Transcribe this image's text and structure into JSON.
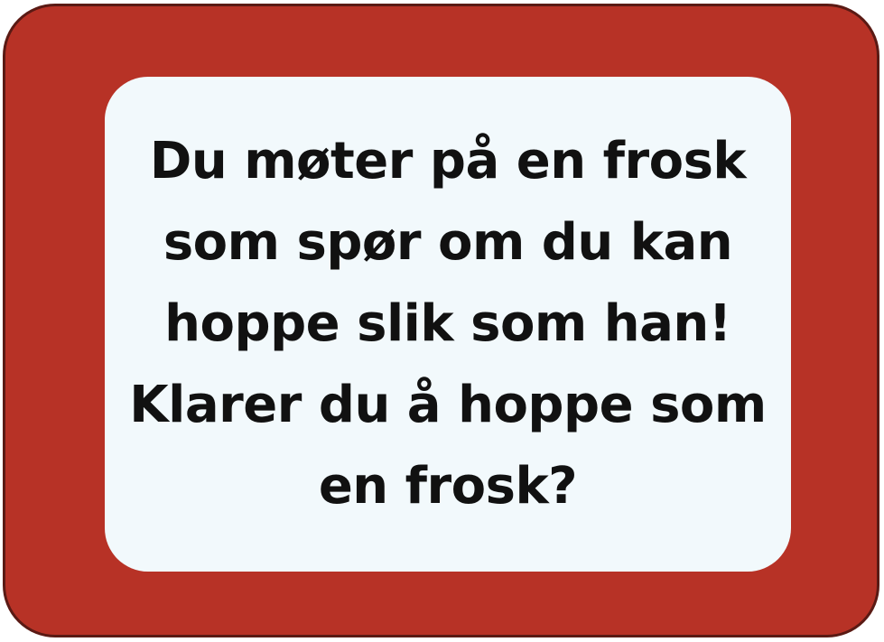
{
  "card": {
    "colors": {
      "frame": "#b73226",
      "frame_border": "#5a1a14",
      "panel": "#f2f9fc",
      "text": "#111111"
    },
    "lines": [
      "Du møter på en frosk",
      "som spør om du kan",
      "hoppe slik som han!",
      "Klarer du å hoppe som",
      "en frosk?"
    ]
  }
}
